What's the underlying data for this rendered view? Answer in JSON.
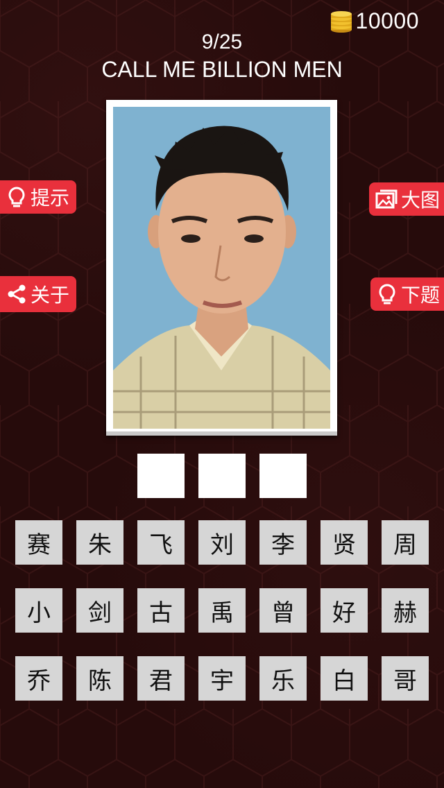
{
  "coins": {
    "count": "10000"
  },
  "header": {
    "level": "9/25",
    "title": "CALL ME BILLION MEN"
  },
  "buttons": {
    "hint": "提示",
    "about": "关于",
    "big_image": "大图",
    "next": "下题"
  },
  "answer": {
    "slots": 3
  },
  "letters": [
    [
      "赛",
      "朱",
      "飞",
      "刘",
      "李",
      "贤",
      "周"
    ],
    [
      "小",
      "剑",
      "古",
      "禹",
      "曾",
      "好",
      "赫"
    ],
    [
      "乔",
      "陈",
      "君",
      "宇",
      "乐",
      "白",
      "哥"
    ]
  ],
  "colors": {
    "background": "#260b0b",
    "button_red": "#e9303c",
    "tile_gray": "#d6d6d6",
    "slot_white": "#ffffff",
    "photo_backdrop": "#7fb2d0",
    "coin_gold": "#f2c12e"
  }
}
